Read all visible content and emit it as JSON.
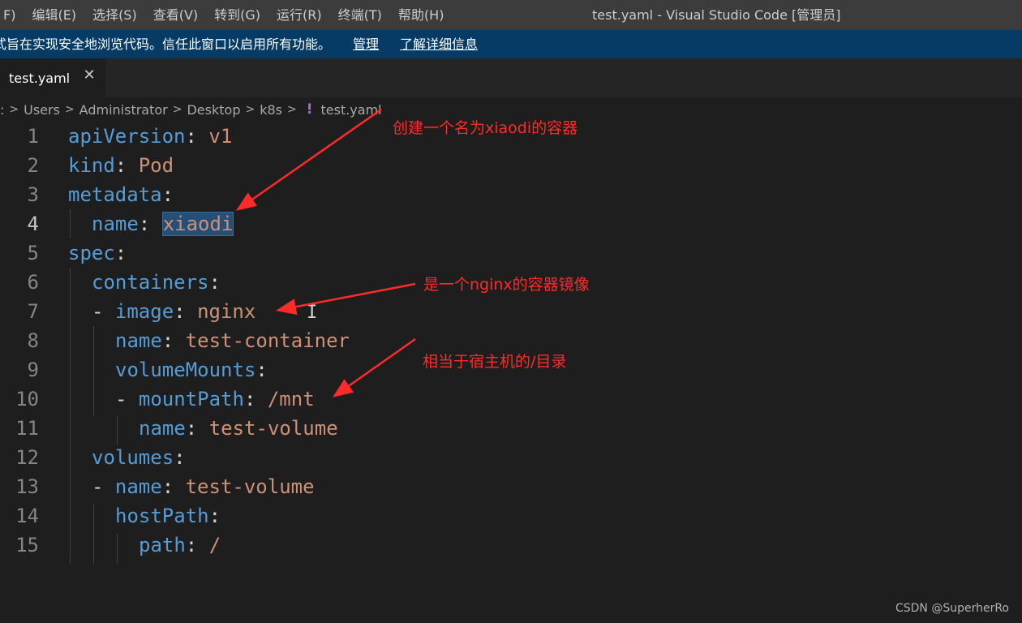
{
  "menu": {
    "items": [
      "F)",
      "编辑(E)",
      "选择(S)",
      "查看(V)",
      "转到(G)",
      "运行(R)",
      "终端(T)",
      "帮助(H)"
    ],
    "window_title": "test.yaml - Visual Studio Code [管理员]"
  },
  "banner": {
    "text": "式旨在实现安全地浏览代码。信任此窗口以启用所有功能。",
    "manage_label": "管理",
    "learn_more_label": "了解详细信息"
  },
  "tab": {
    "label": "test.yaml",
    "close_glyph": "✕"
  },
  "breadcrumb": {
    "items": [
      ":",
      "Users",
      "Administrator",
      "Desktop",
      "k8s"
    ],
    "file_icon": "!",
    "file": "test.yaml"
  },
  "editor": {
    "active_line": 4,
    "lines": [
      {
        "n": "1",
        "k": "apiVersion",
        "v": "v1"
      },
      {
        "n": "2",
        "k": "kind",
        "v": "Pod"
      },
      {
        "n": "3",
        "k": "metadata",
        "v": ""
      },
      {
        "n": "4",
        "k": "name",
        "v": "xiaodi"
      },
      {
        "n": "5",
        "k": "spec",
        "v": ""
      },
      {
        "n": "6",
        "k": "containers",
        "v": ""
      },
      {
        "n": "7",
        "k": "image",
        "v": "nginx"
      },
      {
        "n": "8",
        "k": "name",
        "v": "test-container"
      },
      {
        "n": "9",
        "k": "volumeMounts",
        "v": ""
      },
      {
        "n": "10",
        "k": "mountPath",
        "v": "/mnt"
      },
      {
        "n": "11",
        "k": "name",
        "v": "test-volume"
      },
      {
        "n": "12",
        "k": "volumes",
        "v": ""
      },
      {
        "n": "13",
        "k": "name",
        "v": "test-volume"
      },
      {
        "n": "14",
        "k": "hostPath",
        "v": ""
      },
      {
        "n": "15",
        "k": "path",
        "v": "/"
      }
    ]
  },
  "annotations": {
    "note1": "创建一个名为xiaodi的容器",
    "note2": "是一个nginx的容器镜像",
    "note3": "相当于宿主机的/目录"
  },
  "watermark": "CSDN @SuperherRo",
  "colors": {
    "key": "#569cd6",
    "value": "#ce9178",
    "annotation": "#ff2a2a",
    "banner": "#063b66"
  }
}
